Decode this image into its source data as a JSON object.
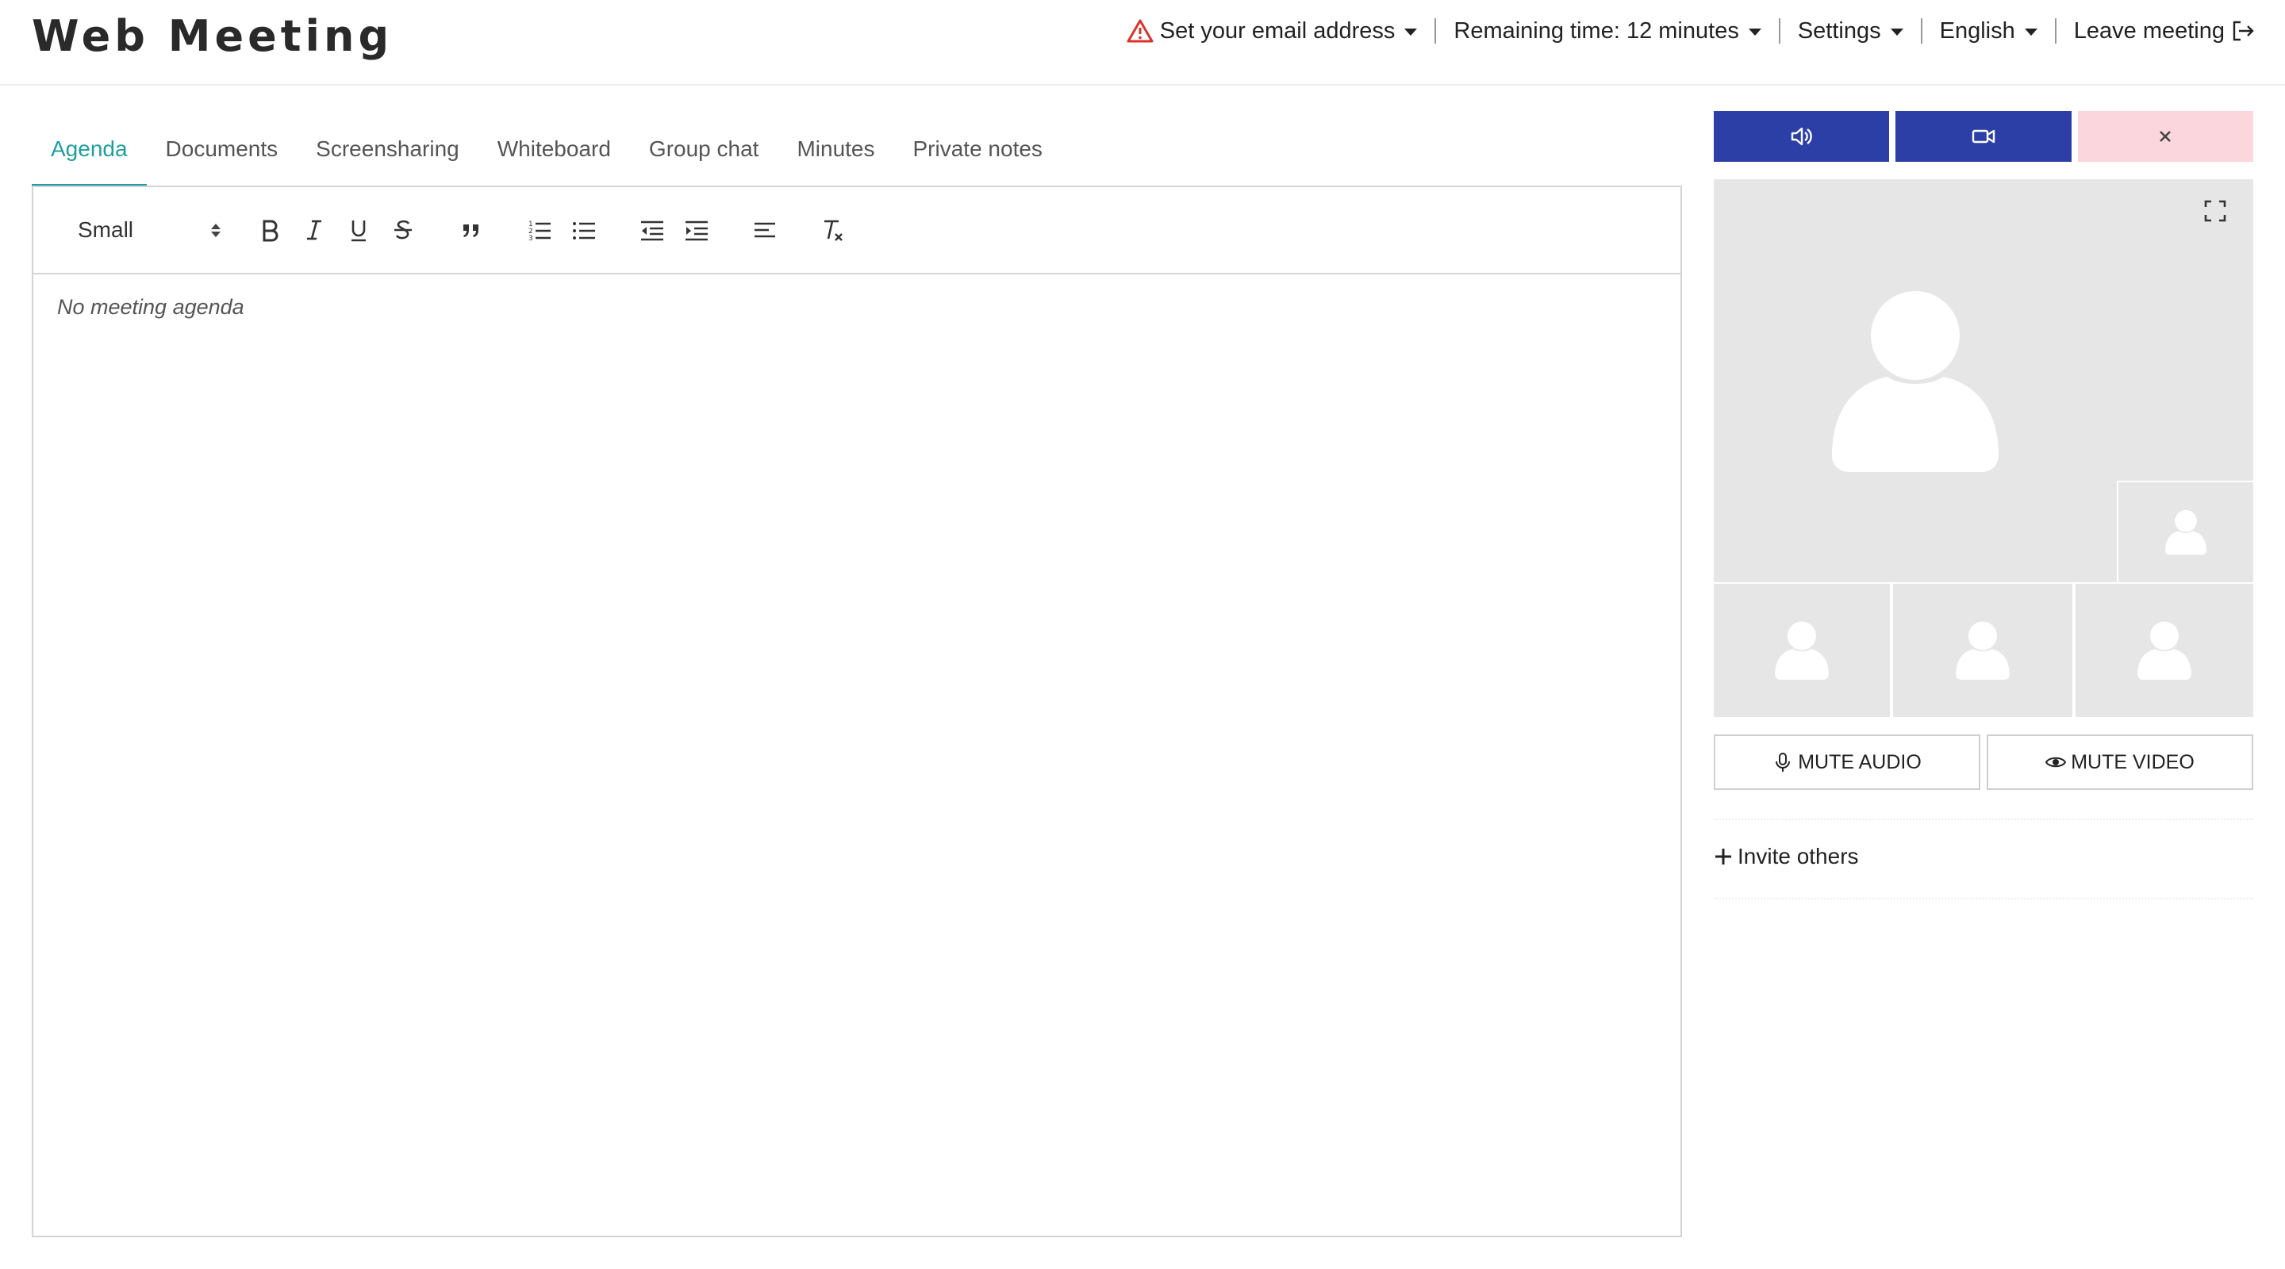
{
  "header": {
    "logo": "Web Meeting",
    "email_warning": "Set your email address",
    "remaining_time": "Remaining time: 12 minutes",
    "settings": "Settings",
    "language": "English",
    "leave": "Leave meeting"
  },
  "tabs": [
    {
      "label": "Agenda",
      "active": true
    },
    {
      "label": "Documents"
    },
    {
      "label": "Screensharing"
    },
    {
      "label": "Whiteboard"
    },
    {
      "label": "Group chat"
    },
    {
      "label": "Minutes"
    },
    {
      "label": "Private notes"
    }
  ],
  "editor": {
    "size_select": "Small",
    "placeholder": "No meeting agenda",
    "toolbar_icons": [
      "bold-icon",
      "italic-icon",
      "underline-icon",
      "strikethrough-icon",
      "blockquote-icon",
      "ordered-list-icon",
      "bullet-list-icon",
      "outdent-icon",
      "indent-icon",
      "align-icon",
      "clear-format-icon"
    ]
  },
  "media": {
    "mute_audio": "MUTE AUDIO",
    "mute_video": "MUTE VIDEO",
    "invite": "Invite others"
  },
  "colors": {
    "accent": "#1f9ea0",
    "control_blue": "#2b3fa6",
    "control_pink": "#fbd6dc",
    "warning_red": "#d9342b",
    "tile_gray": "#e6e6e6"
  }
}
